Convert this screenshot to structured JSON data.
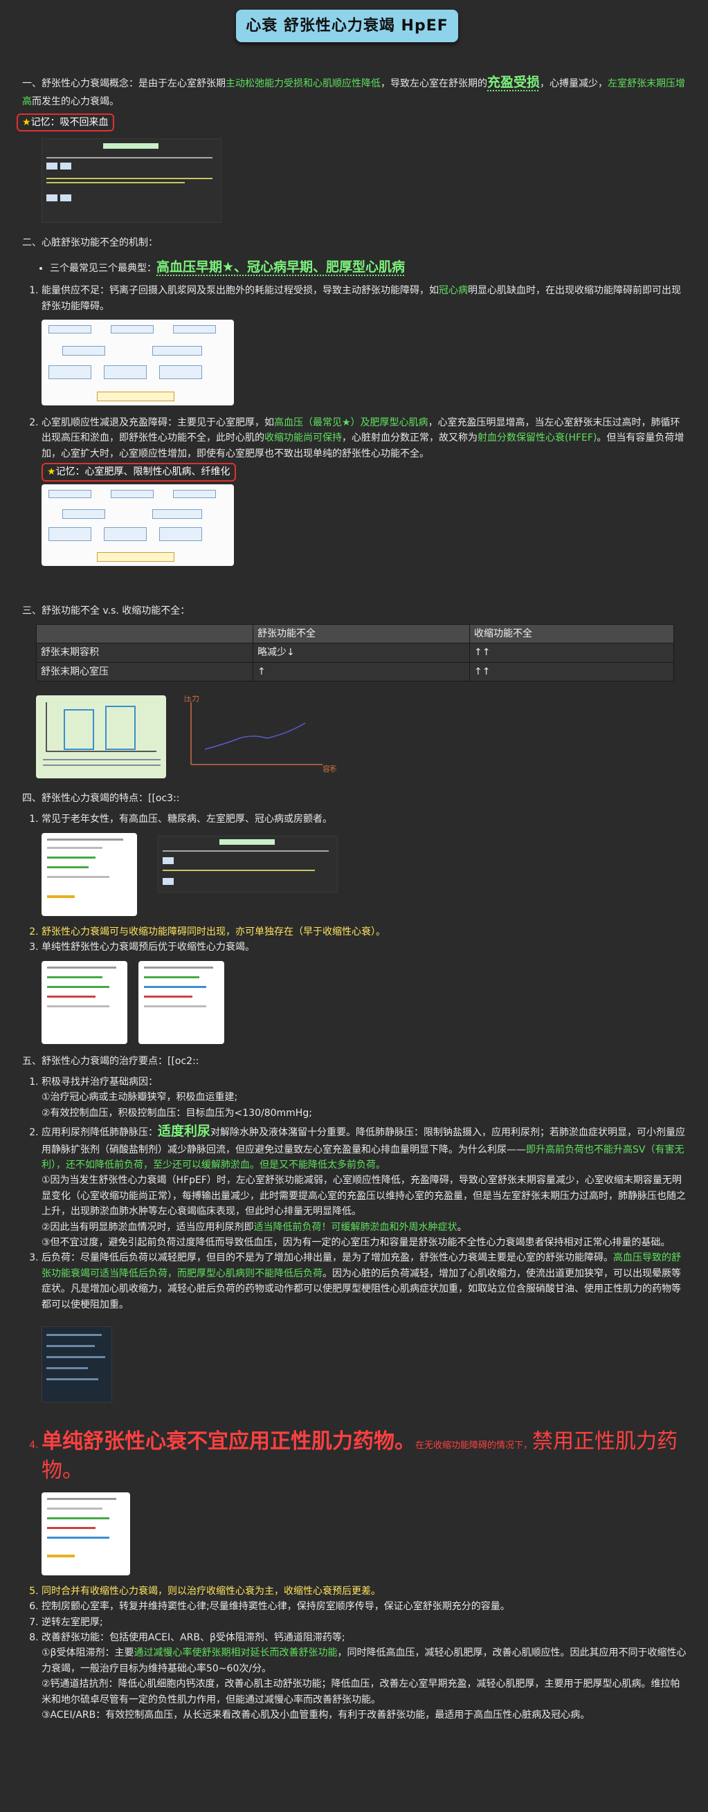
{
  "title": "心衰 舒张性心力衰竭 HpEF",
  "s1": {
    "a": "一、舒张性心力衰竭概念：是由于左心室舒张期",
    "b": "主动松弛能力受损和心肌顺应性降低",
    "c": "，导致左心室在舒张期的",
    "d": "充盈受损",
    "e": "，心搏量减少，",
    "f": "左室舒张末期压增高",
    "g": "而发生的心力衰竭。",
    "memo": "记忆：吸不回来血"
  },
  "s2": {
    "heading": "二、心脏舒张功能不全的机制：",
    "bullet_a": "三个最常见三个最典型：",
    "bullet_b": "高血压早期★、冠心病早期、肥厚型心肌病",
    "i1_a": "能量供应不足：钙离子回摄入肌浆网及泵出胞外的耗能过程受损，导致主动舒张功能障碍，如",
    "i1_b": "冠心病",
    "i1_c": "明显心肌缺血时，在出现收缩功能障碍前即可出现舒张功能障碍。",
    "i2_a": "心室肌顺应性减退及充盈障碍：主要见于心室肥厚，如",
    "i2_b": "高血压（最常见★）及肥厚型心肌病",
    "i2_c": "，心室充盈压明显增高，当左心室舒张末压过高时，肺循环出现高压和淤血，即舒张性心功能不全，此时心肌的",
    "i2_d": "收缩功能尚可保持",
    "i2_e": "，心脏射血分数正常，故又称为",
    "i2_f": "射血分数保留性心衰(HFEF)",
    "i2_g": "。但当有容量负荷增加，心室扩大时，心室顺应性增加，即使有心室肥厚也不致出现单纯的舒张性心功能不全。",
    "memo": "记忆：心室肥厚、限制性心肌病、纤维化"
  },
  "s3": {
    "heading": "三、舒张功能不全 v.s. 收缩功能不全：",
    "headers": [
      "",
      "舒张功能不全",
      "收缩功能不全"
    ],
    "rows": [
      [
        "舒张末期容积",
        "略减少↓",
        "↑↑"
      ],
      [
        "舒张末期心室压",
        "↑",
        "↑↑"
      ]
    ],
    "graph_ylabel": "压力",
    "graph_xlabel": "容积"
  },
  "s4": {
    "heading": "四、舒张性心力衰竭的特点：[[oc3::",
    "i1": "常见于老年女性，有高血压、糖尿病、左室肥厚、冠心病或房颤者。",
    "i2": "舒张性心力衰竭可与收缩功能障碍同时出现，亦可单独存在（早于收缩性心衰）。",
    "i3": "单纯性舒张性心力衰竭预后优于收缩性心力衰竭。"
  },
  "s5": {
    "heading": "五、舒张性心力衰竭的治疗要点：[[oc2::",
    "i1": "积极寻找并治疗基础病因：",
    "i1_l1": "①治疗冠心病或主动脉瓣狭窄，积极血运重建;",
    "i1_l2": "②有效控制血压，积极控制血压：目标血压为<130/80mmHg;",
    "i2_a": "应用利尿剂降低肺静脉压：",
    "i2_b": "适度利尿",
    "i2_c": "对解除水肿及液体潴留十分重要。降低肺静脉压：限制钠盐摄入，应用利尿剂；若肺淤血症状明显，可小剂量应用静脉扩张剂（硝酸盐制剂）减少静脉回流，但应避免过量致左心室充盈量和心排血量明显下降。为什么利尿——",
    "i2_d": "即升高前负荷也不能升高SV（有害无利），还不如降低前负荷，至少还可以缓解肺淤血。但是又不能降低太多前负荷。",
    "i2_e": "①因为当发生舒张性心力衰竭（HFpEF）时，左心室舒张功能减弱，心室顺应性降低，充盈障碍，导致心室舒张末期容量减少，心室收缩末期容量无明显变化（心室收缩功能尚正常），每搏输出量减少，此时需要提高心室的充盈压以维持心室的充盈量，但是当左室舒张末期压力过高时，肺静脉压也随之上升，出现肺淤血肺水肿等左心衰竭临床表现，但此时心排量无明显降低。",
    "i2_f": "②因此当有明显肺淤血情况时，适当应用利尿剂即",
    "i2_g": "适当降低前负荷！可缓解肺淤血和外周水肿症状",
    "i2_h": "。",
    "i2_i": "③但不宜过度，避免引起前负荷过度降低而导致低血压，因为有一定的心室压力和容量是舒张功能不全性心力衰竭患者保持相对正常心排量的基础。",
    "i3_a": "后负荷：尽量降低后负荷以减轻肥厚，但目的不是为了增加心排出量，是为了增加充盈，舒张性心力衰竭主要是心室的舒张功能障碍。",
    "i3_b": "高血压导致的舒张功能衰竭可适当降低后负荷，而肥厚型心肌病则不能降低后负荷",
    "i3_c": "。因为心脏的后负荷减轻，增加了心肌收缩力，使流出道更加狭窄，可以出现晕厥等症状。凡是增加心肌收缩力，减轻心脏后负荷的药物或动作都可以使肥厚型梗阻性心肌病症状加重，如取站立位含服硝酸甘油、使用正性肌力的药物等都可以使梗阻加重。",
    "i4_a": "单纯舒张性心衰不宜应用正性肌力药物。",
    "i4_b": "在无收缩功能障碍的情况下，",
    "i4_c": "禁用正性肌力药物",
    "i4_d": "。",
    "i5": "同时合并有收缩性心力衰竭，则以治疗收缩性心衰为主，收缩性心衰预后更差。",
    "i6": "控制房颤心室率，转复并维持窦性心律;尽量维持窦性心律，保持房室顺序传导，保证心室舒张期充分的容量。",
    "i7": "逆转左室肥厚;",
    "i8": "改善舒张功能：包括使用ACEI、ARB、β受体阻滞剂、钙通道阻滞药等;",
    "i8_l1a": "①β受体阻滞剂：主要",
    "i8_l1b": "通过减慢心率使舒张期相对延长而改善舒张功能",
    "i8_l1c": "，同时降低高血压，减轻心肌肥厚，改善心肌顺应性。因此其应用不同于收缩性心力衰竭，一般治疗目标为维持基础心率50~60次/分。",
    "i8_l2": "②钙通道拮抗剂：降低心肌细胞内钙浓度，改善心肌主动舒张功能；降低血压，改善左心室早期充盈，减轻心肌肥厚，主要用于肥厚型心肌病。维拉帕米和地尔硫卓尽管有一定的负性肌力作用，但能通过减慢心率而改善舒张功能。",
    "i8_l3": "③ACEI/ARB：有效控制高血压，从长远来看改善心肌及小血管重构，有利于改善舒张功能，最适用于高血压性心脏病及冠心病。"
  }
}
